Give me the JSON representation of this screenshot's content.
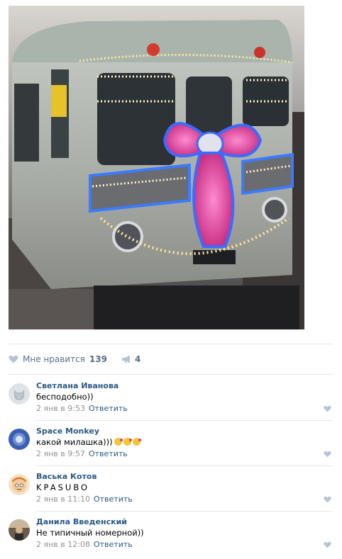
{
  "post": {
    "likes_label": "Мне нравится",
    "likes_count": "139",
    "shares_count": "4"
  },
  "comments": [
    {
      "author": "Светлана Иванова",
      "text": "бесподобно))",
      "date": "2 янв в 9:53",
      "reply": "Ответить"
    },
    {
      "author": "Space Monkey",
      "text": "какой милашка)))",
      "date": "2 янв в 9:57",
      "reply": "Ответить"
    },
    {
      "author": "Васька Котов",
      "text": "KPASUBO",
      "date": "2 янв в 11:10",
      "reply": "Ответить"
    },
    {
      "author": "Данила Введенский",
      "text": "Не типичный номерной))",
      "date": "2 янв в 12:08",
      "reply": "Ответить"
    }
  ],
  "colors": {
    "link": "#2a5885",
    "muted": "#939393",
    "accent_light": "#b6c4d6"
  }
}
